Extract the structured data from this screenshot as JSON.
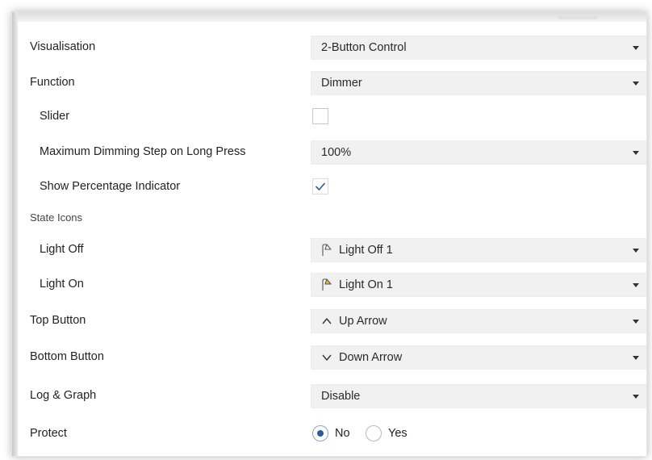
{
  "rows": {
    "visualisation": {
      "label": "Visualisation",
      "value": "2-Button Control"
    },
    "function": {
      "label": "Function",
      "value": "Dimmer"
    },
    "slider": {
      "label": "Slider",
      "checked": false
    },
    "max_dimming": {
      "label": "Maximum Dimming Step on Long Press",
      "value": "100%"
    },
    "show_percentage": {
      "label": "Show Percentage Indicator",
      "checked": true
    },
    "state_icons": {
      "label": "State Icons"
    },
    "light_off": {
      "label": "Light Off",
      "value": "Light Off 1",
      "icon": "lamp-off-icon"
    },
    "light_on": {
      "label": "Light On",
      "value": "Light On 1",
      "icon": "lamp-on-icon"
    },
    "top_button": {
      "label": "Top Button",
      "value": "Up Arrow",
      "icon": "up-arrow-icon"
    },
    "bottom_button": {
      "label": "Bottom Button",
      "value": "Down Arrow",
      "icon": "down-arrow-icon"
    },
    "log_graph": {
      "label": "Log & Graph",
      "value": "Disable"
    },
    "protect": {
      "label": "Protect",
      "options": [
        "No",
        "Yes"
      ],
      "selected": "No"
    }
  },
  "colors": {
    "dropdown_bg": "#f1f1f1",
    "accent": "#2c5d97",
    "lamp_on_fill": "#e8c11a"
  }
}
